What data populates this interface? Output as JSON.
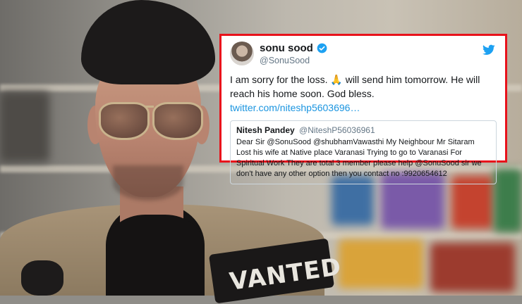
{
  "tweet": {
    "name": "sonu sood",
    "handle": "@SonuSood",
    "text_before_emoji": "I am sorry for the loss. ",
    "emoji": "🙏",
    "text_after_emoji": " will send him tomorrow. He will reach his home soon. God bless. ",
    "link": "twitter.com/niteshp5603696…",
    "icons": {
      "verified": "verified-badge-icon",
      "bird": "twitter-bird-icon"
    },
    "colors": {
      "border": "#e8121b",
      "link": "#1b95e0",
      "handle": "#657786",
      "verified": "#1da1f2"
    }
  },
  "quoted_tweet": {
    "name": "Nitesh Pandey",
    "handle": "@NiteshP56036961",
    "text": "Dear Sir @SonuSood @shubhamVawasthi My Neighbour Mr Sitaram Lost his wife at Native place Varanasi Trying to go to Varanasi For Spiritual Work They are total 3 member please help @SonuSood  sir we don't have any other option then you contact no :9920654612"
  },
  "background": {
    "jacket_patch_text": "VANTED"
  }
}
